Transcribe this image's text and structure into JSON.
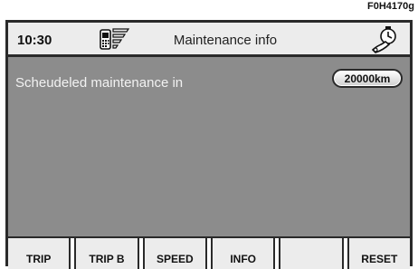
{
  "figure_code": "F0H4170g",
  "header": {
    "time": "10:30",
    "title": "Maintenance info",
    "signal_icon": "phone-signal-icon",
    "service_icon": "service-wrench-clock-icon"
  },
  "content": {
    "label": "Scheudeled maintenance in",
    "value": "20000km"
  },
  "softkeys": [
    "TRIP",
    "TRIP B",
    "SPEED",
    "INFO",
    "",
    "RESET"
  ]
}
